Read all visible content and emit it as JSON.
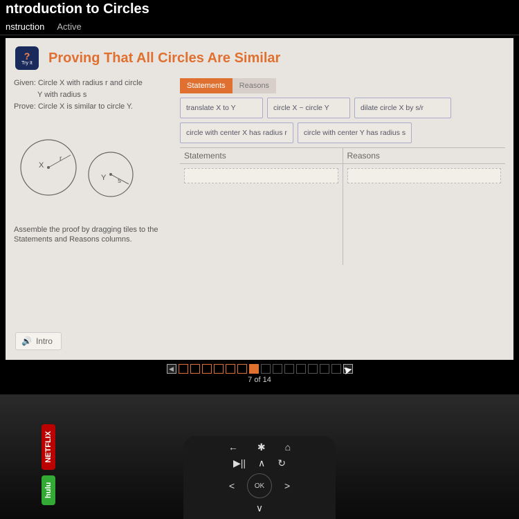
{
  "header": {
    "title": "ntroduction to Circles",
    "tab_instruction": "nstruction",
    "tab_active": "Active"
  },
  "topic": {
    "badge_label": "Try It",
    "title": "Proving That All Circles Are Similar"
  },
  "problem": {
    "given_line1": "Given: Circle X with radius r and circle",
    "given_line2": "Y with radius s",
    "prove": "Prove: Circle X is similar to circle Y.",
    "instructions": "Assemble the proof by dragging tiles to the Statements and Reasons columns.",
    "circle_x_label": "X",
    "circle_x_radius": "r",
    "circle_y_label": "Y",
    "circle_y_radius": "s"
  },
  "tabs": {
    "statements": "Statements",
    "reasons": "Reasons"
  },
  "tiles": {
    "translate": "translate X to Y",
    "similar": "circle X ~ circle Y",
    "dilate": "dilate circle X by s/r",
    "center_x": "circle with center X has radius r",
    "center_y": "circle with center Y has radius s"
  },
  "proof_headers": {
    "statements": "Statements",
    "reasons": "Reasons"
  },
  "intro_button": "Intro",
  "pager": {
    "current": 7,
    "total": 14,
    "text": "7 of 14"
  },
  "remote": {
    "ok": "OK",
    "netflix": "NETFLIX",
    "hulu": "hulu"
  }
}
